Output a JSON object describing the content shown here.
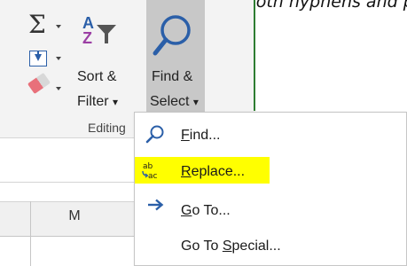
{
  "caption": {
    "text": "numbers contain both hyphens and pa"
  },
  "ribbon": {
    "autosum_symbol": "Σ",
    "sort_filter": {
      "line1": "Sort &",
      "line2": "Filter",
      "dropdown_arrow": "▾"
    },
    "find_select": {
      "line1": "Find &",
      "line2": "Select",
      "dropdown_arrow": "▾"
    },
    "group_label": "Editing"
  },
  "sheet": {
    "column_header": "M"
  },
  "menu": {
    "items": [
      {
        "label": "Find...",
        "access_key_index": 0,
        "icon": "magnifier-icon"
      },
      {
        "label": "Replace...",
        "access_key_index": 0,
        "icon": "replace-icon",
        "highlighted": true
      },
      {
        "label": "Go To...",
        "access_key_index": 0,
        "icon": "arrow-right-icon"
      },
      {
        "label": "Go To Special...",
        "access_key_index": 6,
        "icon": ""
      }
    ]
  },
  "colors": {
    "ribbon_bg": "#f3f3f3",
    "pressed_button_bg": "#c8c8c8",
    "accent_blue": "#2b5fa8",
    "highlight_yellow": "#ffff00",
    "sheet_green": "#2e7d32"
  }
}
